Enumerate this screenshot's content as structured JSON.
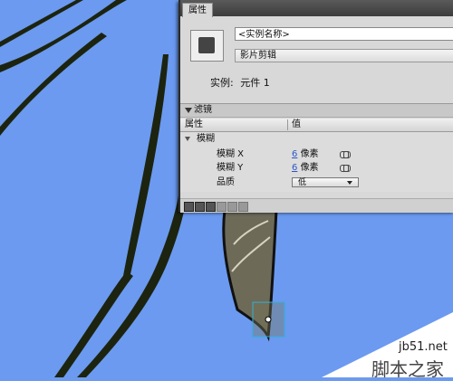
{
  "panel": {
    "tab_label": "属性",
    "instance_name_placeholder": "<实例名称>",
    "symbol_type": "影片剪辑",
    "instance_label": "实例:",
    "instance_value": "元件 1"
  },
  "filters": {
    "header": "滤镜",
    "col_property": "属性",
    "col_value": "值",
    "group_name": "模糊",
    "rows": [
      {
        "name": "模糊 X",
        "value": "6",
        "unit": "像素"
      },
      {
        "name": "模糊 Y",
        "value": "6",
        "unit": "像素"
      }
    ],
    "quality_label": "品质",
    "quality_value": "低"
  },
  "watermark": {
    "site": "jb51.net",
    "brand": "脚本之家"
  },
  "colors": {
    "canvas_bg": "#6b9af0",
    "panel_bg": "#d8d8d8",
    "link_value": "#2b56c9"
  }
}
